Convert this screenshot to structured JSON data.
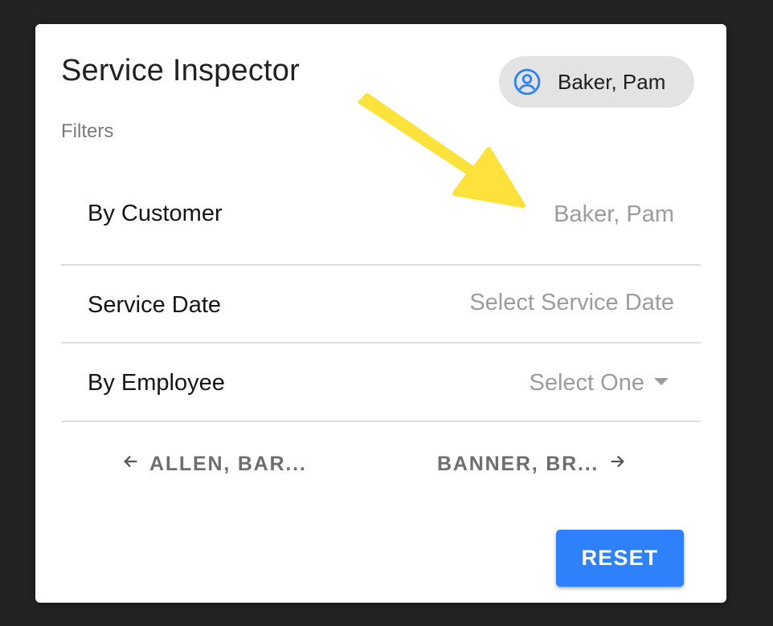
{
  "header": {
    "title": "Service Inspector",
    "user_chip": {
      "label": "Baker, Pam",
      "icon": "account-circle-icon"
    }
  },
  "filters": {
    "section_label": "Filters",
    "rows": [
      {
        "label": "By Customer",
        "value": "Baker, Pam"
      },
      {
        "label": "Service Date",
        "value": "Select Service Date"
      },
      {
        "label": "By Employee",
        "value": "Select One",
        "icon": "dropdown-caret-icon"
      }
    ]
  },
  "pager": {
    "prev_label": "ALLEN, BAR...",
    "prev_icon": "arrow-left-icon",
    "next_label": "BANNER, BR...",
    "next_icon": "arrow-right-icon"
  },
  "actions": {
    "reset_label": "RESET"
  },
  "colors": {
    "accent": "#2f80fb",
    "annotation_arrow": "#fde23b",
    "backdrop": "#232323"
  }
}
